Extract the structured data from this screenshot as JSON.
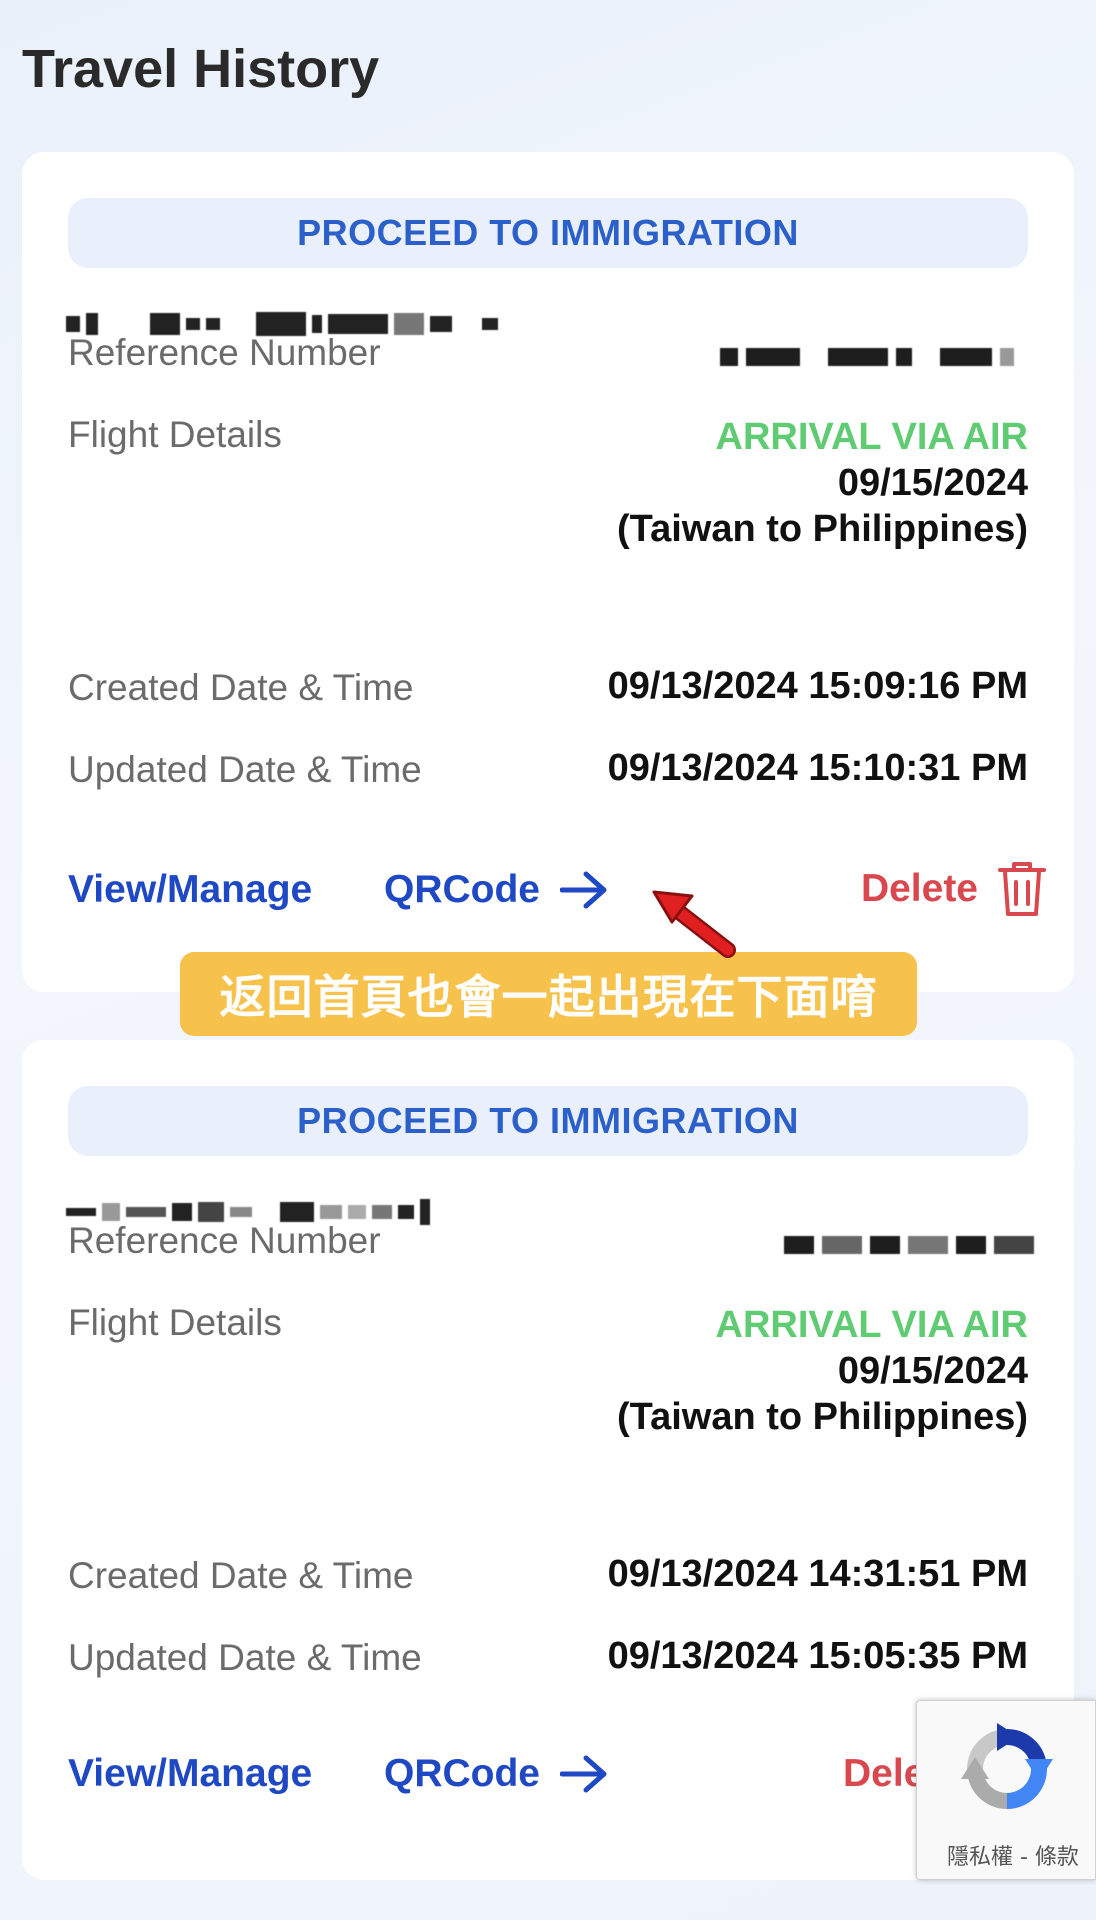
{
  "page": {
    "title": "Travel History"
  },
  "labels": {
    "reference": "Reference Number",
    "flight": "Flight Details",
    "created": "Created Date & Time",
    "updated": "Updated Date & Time"
  },
  "actions": {
    "view_manage": "View/Manage",
    "qrcode": "QRCode",
    "delete": "Delete",
    "delete_truncated": "Delet"
  },
  "cards": [
    {
      "status": "PROCEED TO IMMIGRATION",
      "flight_type": "ARRIVAL VIA AIR",
      "flight_date": "09/15/2024",
      "flight_route": "(Taiwan to Philippines)",
      "created": "09/13/2024 15:09:16 PM",
      "updated": "09/13/2024 15:10:31 PM"
    },
    {
      "status": "PROCEED TO IMMIGRATION",
      "flight_type": "ARRIVAL VIA AIR",
      "flight_date": "09/15/2024",
      "flight_route": "(Taiwan to Philippines)",
      "created": "09/13/2024 14:31:51 PM",
      "updated": "09/13/2024 15:05:35 PM"
    }
  ],
  "caption": "返回首頁也會一起出現在下面唷",
  "recaptcha": {
    "privacy_text": "隱私權 - 條款"
  },
  "colors": {
    "accent_blue": "#1e48c4",
    "status_blue": "#2b5fc9",
    "arrival_green": "#5fcb72",
    "delete_red": "#d9484e",
    "caption_yellow": "#f6c24c"
  }
}
